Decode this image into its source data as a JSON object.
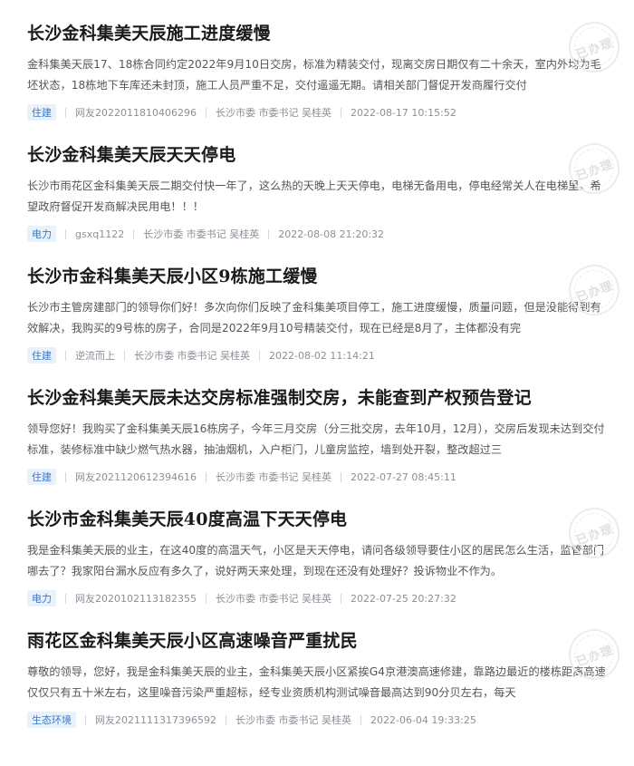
{
  "stamp_text": "已办理",
  "items": [
    {
      "title": "长沙金科集美天辰施工进度缓慢",
      "summary": "金科集美天辰17、18栋合同约定2022年9月10日交房，标准为精装交付，现离交房日期仅有二十余天，室内外均为毛坯状态，18栋地下车库还未封顶，施工人员严重不足，交付遥遥无期。请相关部门督促开发商履行交付",
      "tag": "住建",
      "user": "网友2022011810406296",
      "dept": "长沙市委 市委书记 吴桂英",
      "time": "2022-08-17 10:15:52"
    },
    {
      "title": "长沙金科集美天辰天天停电",
      "summary": "长沙市雨花区金科集美天辰二期交付快一年了，这么热的天晚上天天停电，电梯无备用电，停电经常关人在电梯里。希望政府督促开发商解决民用电！！！",
      "tag": "电力",
      "user": "gsxq1122",
      "dept": "长沙市委 市委书记 吴桂英",
      "time": "2022-08-08 21:20:32"
    },
    {
      "title": "长沙市金科集美天辰小区9栋施工缓慢",
      "summary": "长沙市主管房建部门的领导你们好！多次向你们反映了金科集美项目停工，施工进度缓慢，质量问题，但是没能得到有效解决，我购买的9号栋的房子，合同是2022年9月10号精装交付，现在已经是8月了，主体都没有完",
      "tag": "住建",
      "user": "逆流而上",
      "dept": "长沙市委 市委书记 吴桂英",
      "time": "2022-08-02 11:14:21"
    },
    {
      "title": "长沙金科集美天辰未达交房标准强制交房，未能查到产权预告登记",
      "summary": "领导您好！我购买了金科集美天辰16栋房子，今年三月交房（分三批交房，去年10月，12月），交房后发现未达到交付标准，装修标准中缺少燃气热水器，抽油烟机，入户柜门，儿童房监控，墙到处开裂，整改超过三",
      "tag": "住建",
      "user": "网友2021120612394616",
      "dept": "长沙市委 市委书记 吴桂英",
      "time": "2022-07-27 08:45:11"
    },
    {
      "title": "长沙市金科集美天辰40度高温下天天停电",
      "summary": "我是金科集美天辰的业主，在这40度的高温天气，小区是天天停电，请问各级领导要住小区的居民怎么生活，监管部门哪去了？我家阳台漏水反应有多久了，说好两天来处理，到现在还没有处理好？投诉物业不作为。",
      "tag": "电力",
      "user": "网友2020102113182355",
      "dept": "长沙市委 市委书记 吴桂英",
      "time": "2022-07-25 20:27:32"
    },
    {
      "title": "雨花区金科集美天辰小区高速噪音严重扰民",
      "summary": "尊敬的领导，您好，我是金科集美天辰的业主，金科集美天辰小区紧挨G4京港澳高速修建，靠路边最近的楼栋距离高速仅仅只有五十米左右，这里噪音污染严重超标，经专业资质机构测试噪音最高达到90分贝左右，每天",
      "tag": "生态环境",
      "user": "网友2021111317396592",
      "dept": "长沙市委 市委书记 吴桂英",
      "time": "2022-06-04 19:33:25"
    }
  ]
}
